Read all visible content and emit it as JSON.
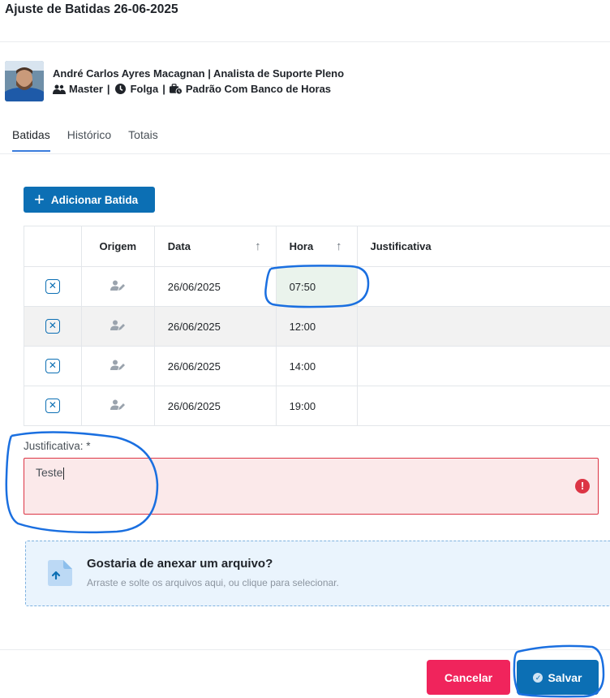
{
  "modal": {
    "title": "Ajuste de Batidas 26-06-2025"
  },
  "employee": {
    "name_role": "André Carlos Ayres Macagnan | Analista de Suporte Pleno",
    "group": "Master",
    "schedule": "Folga",
    "policy": "Padrão Com Banco de Horas",
    "separator": "|"
  },
  "tabs": [
    {
      "label": "Batidas",
      "active": true
    },
    {
      "label": "Histórico",
      "active": false
    },
    {
      "label": "Totais",
      "active": false
    }
  ],
  "add_button": {
    "label": "Adicionar Batida",
    "icon": "plus-icon"
  },
  "table": {
    "headers": {
      "origem": "Origem",
      "data": "Data",
      "hora": "Hora",
      "justificativa": "Justificativa"
    },
    "sort_arrow": "↑",
    "rows": [
      {
        "data": "26/06/2025",
        "hora": "07:50",
        "justificativa": ""
      },
      {
        "data": "26/06/2025",
        "hora": "12:00",
        "justificativa": ""
      },
      {
        "data": "26/06/2025",
        "hora": "14:00",
        "justificativa": ""
      },
      {
        "data": "26/06/2025",
        "hora": "19:00",
        "justificativa": ""
      }
    ]
  },
  "justification": {
    "label": "Justificativa: *",
    "value": "Teste",
    "error_icon": "!"
  },
  "upload": {
    "title": "Gostaria de anexar um arquivo?",
    "subtitle": "Arraste e solte os arquivos aqui, ou clique para selecionar."
  },
  "footer": {
    "cancel_label": "Cancelar",
    "save_label": "Salvar"
  },
  "colors": {
    "primary": "#0c6fb4",
    "danger": "#f0245c",
    "error_border": "#dc3545",
    "annotation": "#1a6fe0"
  }
}
